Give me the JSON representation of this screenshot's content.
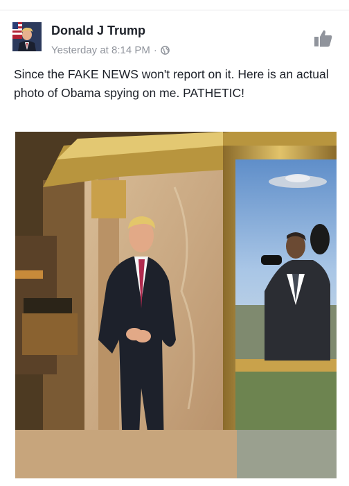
{
  "post": {
    "author": "Donald J Trump",
    "timestamp": "Yesterday at 8:14 PM",
    "separator": "·",
    "audience_icon": "globe-icon",
    "like_icon": "thumbs-up-icon",
    "text": "Since the FAKE NEWS won't report on it. Here is an actual photo of Obama spying on me. PATHETIC!"
  },
  "colors": {
    "name_text": "#1d2129",
    "meta_text": "#90949c",
    "like_icon": "#90949c"
  }
}
